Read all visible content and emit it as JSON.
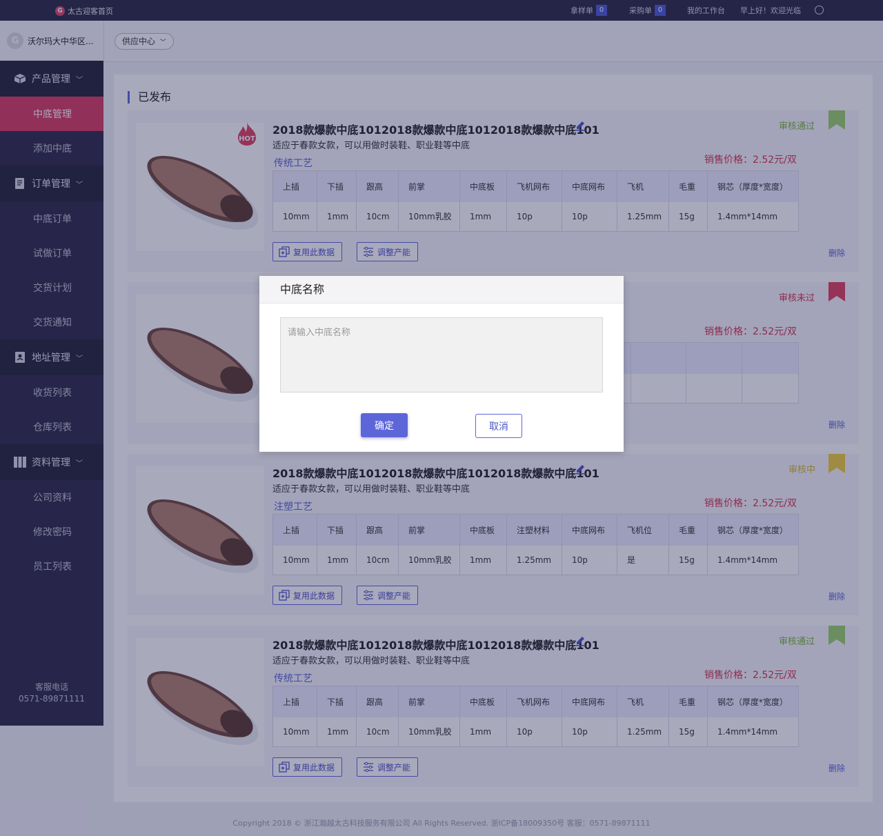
{
  "topbar": {
    "home": "太古迎客首页",
    "sample_label": "拿样单",
    "sample_count": "0",
    "purchase_label": "采购单",
    "purchase_count": "0",
    "workbench": "我的工作台",
    "greeting": "早上好！欢迎光临"
  },
  "header": {
    "company": "沃尔玛大中华区...",
    "supply_center": "供应中心"
  },
  "sidebar": {
    "groups": [
      {
        "label": "产品管理",
        "items": [
          "中底管理",
          "添加中底"
        ]
      },
      {
        "label": "订单管理",
        "items": [
          "中底订单",
          "试做订单",
          "交货计划",
          "交货通知"
        ]
      },
      {
        "label": "地址管理",
        "items": [
          "收货列表",
          "仓库列表"
        ]
      },
      {
        "label": "资料管理",
        "items": [
          "公司资料",
          "修改密码",
          "员工列表"
        ]
      }
    ],
    "phone_label": "客服电话",
    "phone": "0571-89871111"
  },
  "main": {
    "section_title": "已发布",
    "cards": [
      {
        "hot": "HOT",
        "title": "2018款爆款中底1012018款爆款中底1012018款爆款中底101",
        "desc": "适应于春款女款，可以用做时装鞋、职业鞋等中底",
        "craft": "传统工艺",
        "status": "审核通过",
        "status_color": "#7db43c",
        "price": "销售价格：2.52元/双",
        "headers": [
          "上插",
          "下插",
          "跟高",
          "前掌",
          "中底板",
          "飞机网布",
          "中底网布",
          "飞机",
          "毛重",
          "钢芯（厚度*宽度）"
        ],
        "values": [
          "10mm",
          "1mm",
          "10cm",
          "10mm乳胶",
          "1mm",
          "10p",
          "10p",
          "1.25mm",
          "15g",
          "1.4mm*14mm"
        ],
        "copy_btn": "复用此数据",
        "adjust_btn": "调整产能",
        "delete": "删除"
      },
      {
        "status": "审核未过",
        "status_color": "#d8304e",
        "price": "销售价格：2.52元/双",
        "delete": "删除"
      },
      {
        "title": "2018款爆款中底1012018款爆款中底1012018款爆款中底101",
        "desc": "适应于春款女款，可以用做时装鞋、职业鞋等中底",
        "craft": "注塑工艺",
        "status": "审核中",
        "status_color": "#d9b62a",
        "price": "销售价格：2.52元/双",
        "headers": [
          "上插",
          "下插",
          "跟高",
          "前掌",
          "中底板",
          "注塑材料",
          "中底网布",
          "飞机位",
          "毛重",
          "钢芯（厚度*宽度）"
        ],
        "values": [
          "10mm",
          "1mm",
          "10cm",
          "10mm乳胶",
          "1mm",
          "1.25mm",
          "10p",
          "是",
          "15g",
          "1.4mm*14mm"
        ],
        "copy_btn": "复用此数据",
        "adjust_btn": "调整产能",
        "delete": "删除"
      },
      {
        "title": "2018款爆款中底1012018款爆款中底1012018款爆款中底101",
        "desc": "适应于春款女款，可以用做时装鞋、职业鞋等中底",
        "craft": "传统工艺",
        "status": "审核通过",
        "status_color": "#7db43c",
        "price": "销售价格：2.52元/双",
        "headers": [
          "上插",
          "下插",
          "跟高",
          "前掌",
          "中底板",
          "飞机网布",
          "中底网布",
          "飞机",
          "毛重",
          "钢芯（厚度*宽度）"
        ],
        "values": [
          "10mm",
          "1mm",
          "10cm",
          "10mm乳胶",
          "1mm",
          "10p",
          "10p",
          "1.25mm",
          "15g",
          "1.4mm*14mm"
        ],
        "copy_btn": "复用此数据",
        "adjust_btn": "调整产能",
        "delete": "删除"
      }
    ]
  },
  "footer": "Copyright 2018 © 浙江瀚越太古科技服务有限公司 All Rights Reserved.  浙ICP备18009350号  客服：0571-89871111",
  "modal": {
    "title": "中底名称",
    "placeholder": "请输入中底名称",
    "value": "",
    "confirm": "确定",
    "cancel": "取消"
  }
}
